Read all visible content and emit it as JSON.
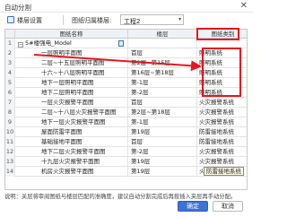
{
  "window": {
    "title": "自动分割",
    "close_glyph": "✕"
  },
  "toolbar": {
    "floor_settings": "楼层设置",
    "project_floor_label": "图纸归属楼层:",
    "project_value": "工程2",
    "dropdown_glyph": "▾"
  },
  "table": {
    "columns": [
      "图纸名称",
      "楼层",
      "图纸类别"
    ],
    "group": {
      "num": "1",
      "expand_glyph": "−",
      "name": "5#楼强电_Model"
    },
    "rows": [
      {
        "num": "2",
        "name": "一层照明平面图",
        "floor": "首层",
        "category": "照明系统"
      },
      {
        "num": "3",
        "name": "二层~十五层照明平面图",
        "floor": "第2层~第15层",
        "category": "照明系统"
      },
      {
        "num": "4",
        "name": "十六~十八层照明平面图",
        "floor": "第16层~第18层",
        "category": "照明系统"
      },
      {
        "num": "5",
        "name": "地下一层照明平面图",
        "floor": "第-1层",
        "category": "照明系统"
      },
      {
        "num": "6",
        "name": "地下二层照明平面图",
        "floor": "第-2层",
        "category": "照明系统"
      },
      {
        "num": "7",
        "name": "一层火灾报警平面图",
        "floor": "首层",
        "category": "火灾报警系统"
      },
      {
        "num": "8",
        "name": "二层~十八层火灾报警平面图",
        "floor": "第2层~第18层",
        "category": "火灾报警系统"
      },
      {
        "num": "9",
        "name": "地下一层火灾报警平面图",
        "floor": "第-1层",
        "category": "火灾报警系统"
      },
      {
        "num": "10",
        "name": "屋面防雷平面图",
        "floor": "第19层",
        "category": "防雷接地系统"
      },
      {
        "num": "11",
        "name": "基础接地平面图",
        "floor": "首层",
        "category": "防雷接地系统"
      },
      {
        "num": "12",
        "name": "地下二层火灾报警平面图",
        "floor": "第-2层",
        "category": "火灾报警系统"
      },
      {
        "num": "13",
        "name": "十九层火灾报警平面图",
        "floor": "第19层",
        "category": "火灾报警系统"
      },
      {
        "num": "14",
        "name": "机房火灾报警平面图",
        "floor": "第19层",
        "category": "火灾报警系统"
      }
    ],
    "tooltip": "防雷接地系统"
  },
  "footer": {
    "note": "说明：关层将审阅图纸与楼层匹配的准确度，建议自动分割完成后再按插入夹层再手动分配。",
    "ok_label": "确定",
    "cancel_label": "取消"
  },
  "annotation_color": "#e8161e"
}
